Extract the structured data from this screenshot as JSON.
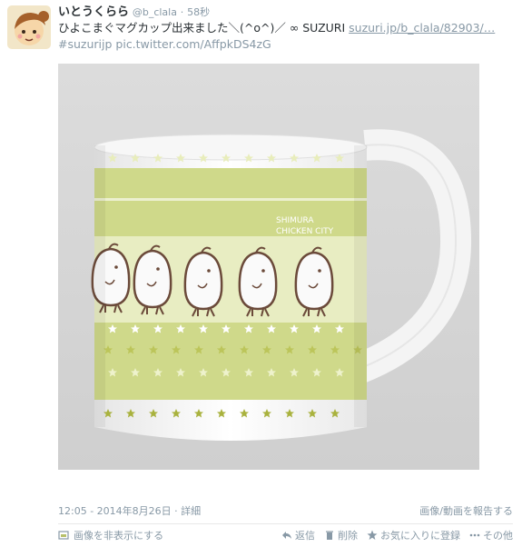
{
  "tweet": {
    "display_name": "いとうくらら",
    "handle": "@b_clala",
    "separator": "·",
    "time_ago": "58秒",
    "text_main": "ひよこまぐマグカップ出来ました＼(^o^)／ ∞ SUZURI ",
    "link_text": "suzuri.jp/b_clala/82903/…",
    "hashtag": "#suzurijp",
    "pic_link": "pic.twitter.com/AffpkDS4zG"
  },
  "meta": {
    "timestamp": "12:05 - 2014年8月26日",
    "details_sep": "·",
    "details_label": "詳細",
    "report_label": "画像/動画を報告する"
  },
  "actions": {
    "hide_image": "画像を非表示にする",
    "reply": "返信",
    "delete": "削除",
    "favorite": "お気に入りに登録",
    "more": "その他"
  },
  "mug": {
    "printed_text_line1": "SHIMURA",
    "printed_text_line2": "CHICKEN CITY"
  },
  "colors": {
    "mug_band": "#cfd98a",
    "star_light": "#e4e8b0",
    "star_dark": "#a9b23e",
    "chick_outline": "#6b4a3a",
    "accent_link": "#8899a6"
  }
}
